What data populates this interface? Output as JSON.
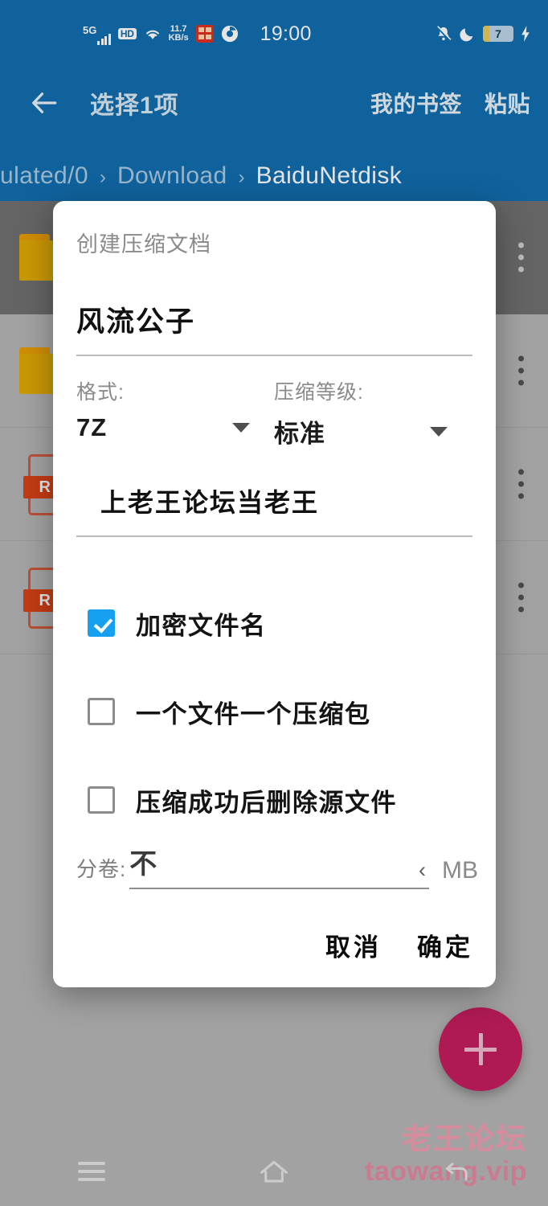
{
  "status_bar": {
    "network_type": "5G",
    "hd_badge": "HD",
    "net_speed_value": "11.7",
    "net_speed_unit": "KB/s",
    "time": "19:00",
    "battery_level": "7",
    "icons": [
      "signal-5g-icon",
      "hd-icon",
      "wifi-icon",
      "network-speed-icon",
      "red-app-icon",
      "browser-icon",
      "mute-icon",
      "moon-icon",
      "battery-icon",
      "charging-bolt-icon"
    ]
  },
  "app_bar": {
    "back_icon": "back-arrow-icon",
    "title": "选择1项",
    "actions": [
      "我的书签",
      "粘贴"
    ],
    "breadcrumb": [
      "ulated/0",
      "Download",
      "BaiduNetdisk"
    ],
    "breadcrumb_separator": "›",
    "background_color": "#0d6aad"
  },
  "file_list": {
    "rows": [
      {
        "icon": "folder-icon",
        "selected": true,
        "overflow": "more-vertical-icon"
      },
      {
        "icon": "folder-icon",
        "selected": false,
        "overflow": "more-vertical-icon"
      },
      {
        "icon": "rar-file-icon",
        "badge": "R",
        "selected": false,
        "overflow": "more-vertical-icon"
      },
      {
        "icon": "rar-file-icon",
        "badge": "R",
        "selected": false,
        "overflow": "more-vertical-icon"
      }
    ]
  },
  "fab": {
    "icon": "plus-icon",
    "color": "#c2185b"
  },
  "watermark": {
    "line1": "老王论坛",
    "line2": "taowang.vip",
    "color": "#f09aaf"
  },
  "nav_bar": {
    "recents_icon": "menu-icon",
    "home_icon": "home-icon",
    "back_icon": "back-arrow-icon"
  },
  "dialog": {
    "title": "创建压缩文档",
    "archive_name": "风流公子",
    "format": {
      "label": "格式:",
      "value": "7Z",
      "caret": "chevron-down-icon"
    },
    "level": {
      "label": "压缩等级:",
      "value": "标准",
      "caret": "chevron-down-icon"
    },
    "password": "上老王论坛当老王",
    "checkboxes": [
      {
        "label": "加密文件名",
        "checked": true
      },
      {
        "label": "一个文件一个压缩包",
        "checked": false
      },
      {
        "label": "压缩成功后删除源文件",
        "checked": false
      }
    ],
    "split": {
      "label": "分卷:",
      "value": "不",
      "chevron": "‹",
      "unit": "MB"
    },
    "buttons": {
      "cancel": "取消",
      "confirm": "确定"
    },
    "accent_color": "#18a0f0"
  }
}
